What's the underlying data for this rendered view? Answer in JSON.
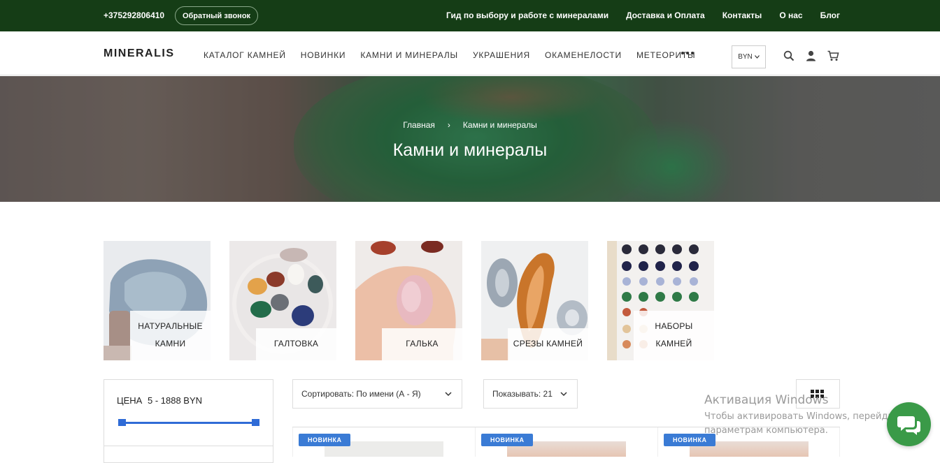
{
  "topbar": {
    "phone": "+375292806410",
    "callback_label": "Обратный звонок",
    "links": [
      "Гид по выбору и работе с минералами",
      "Доставка и Оплата",
      "Контакты",
      "О нас",
      "Блог"
    ]
  },
  "header": {
    "logo": "MINERALIS",
    "nav": [
      "КАТАЛОГ КАМНЕЙ",
      "НОВИНКИ",
      "КАМНИ И МИНЕРАЛЫ",
      "УКРАШЕНИЯ",
      "ОКАМЕНЕЛОСТИ",
      "МЕТЕОРИТЫ"
    ],
    "currency": "BYN",
    "icons": [
      "more-dots-icon",
      "search-icon",
      "user-icon",
      "cart-icon"
    ]
  },
  "hero": {
    "breadcrumb_home": "Главная",
    "breadcrumb_separator": "›",
    "breadcrumb_current": "Камни и минералы",
    "title": "Камни и минералы"
  },
  "categories": [
    {
      "label": "НАТУРАЛЬНЫЕ КАМНИ",
      "lines": [
        "НАТУРАЛЬНЫЕ",
        "КАМНИ"
      ]
    },
    {
      "label": "ГАЛТОВКА",
      "lines": [
        "ГАЛТОВКА"
      ]
    },
    {
      "label": "ГАЛЬКА",
      "lines": [
        "ГАЛЬКА"
      ]
    },
    {
      "label": "СРЕЗЫ КАМНЕЙ",
      "lines": [
        "СРЕЗЫ КАМНЕЙ"
      ]
    },
    {
      "label": "НАБОРЫ КАМНЕЙ",
      "lines": [
        "НАБОРЫ",
        "КАМНЕЙ"
      ]
    }
  ],
  "filter": {
    "title": "ЦЕНА",
    "range": "5 - 1888 BYN"
  },
  "toolbar": {
    "sort_label": "Сортировать: По имени (А - Я)",
    "show_label": "Показывать: 21"
  },
  "products": [
    {
      "badge": "НОВИНКА"
    },
    {
      "badge": "НОВИНКА"
    },
    {
      "badge": "НОВИНКА"
    }
  ],
  "watermark": {
    "line1": "Активация Windows",
    "line2": "Чтобы активировать Windows, перейдите к",
    "line3": "параметрам компьютера."
  },
  "colors": {
    "topbar": "#153d16",
    "accent": "#2f6bd6",
    "badge": "#3a7bd5",
    "chat": "#3a9a48"
  }
}
